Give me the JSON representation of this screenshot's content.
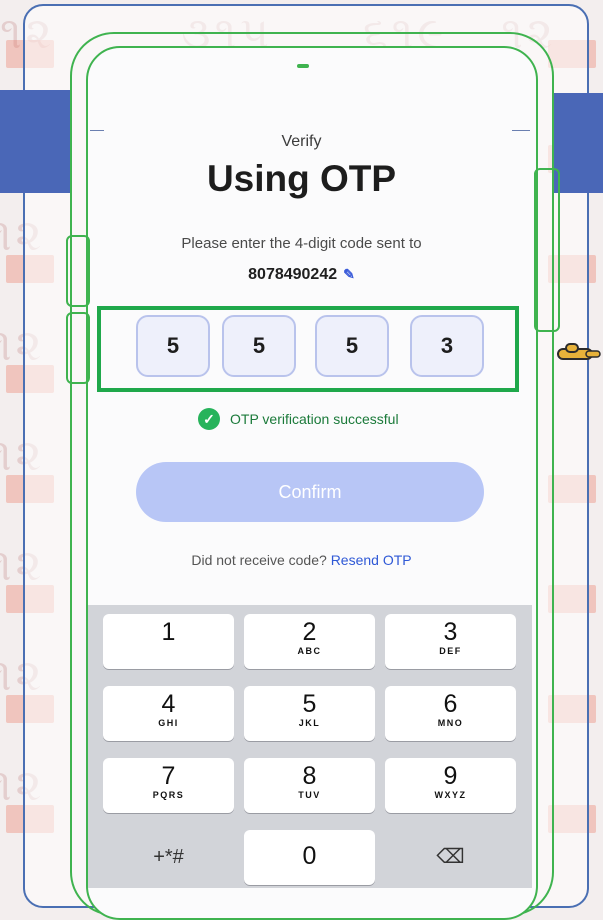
{
  "screen": {
    "verify_label": "Verify",
    "title": "Using OTP",
    "instruction": "Please enter the 4-digit code sent to",
    "phone_number": "8078490242",
    "edit_icon": "pencil-icon"
  },
  "otp": {
    "digits": [
      "5",
      "5",
      "5",
      "3"
    ]
  },
  "status": {
    "icon": "check-circle-icon",
    "message": "OTP verification successful",
    "color": "#27b35b"
  },
  "actions": {
    "confirm_label": "Confirm",
    "resend_prompt": "Did not receive code?",
    "resend_link": "Resend OTP"
  },
  "keypad": {
    "keys": [
      {
        "num": "1",
        "letters": ""
      },
      {
        "num": "2",
        "letters": "ABC"
      },
      {
        "num": "3",
        "letters": "DEF"
      },
      {
        "num": "4",
        "letters": "GHI"
      },
      {
        "num": "5",
        "letters": "JKL"
      },
      {
        "num": "6",
        "letters": "MNO"
      },
      {
        "num": "7",
        "letters": "PQRS"
      },
      {
        "num": "8",
        "letters": "TUV"
      },
      {
        "num": "9",
        "letters": "WXYZ"
      }
    ],
    "symbols_label": "+*#",
    "zero": "0",
    "backspace_icon": "backspace-icon"
  },
  "colors": {
    "accent_blue": "#4a67b7",
    "highlight_green": "#1fa84b",
    "confirm_button": "#b8c6f6",
    "link": "#2f59d6"
  }
}
